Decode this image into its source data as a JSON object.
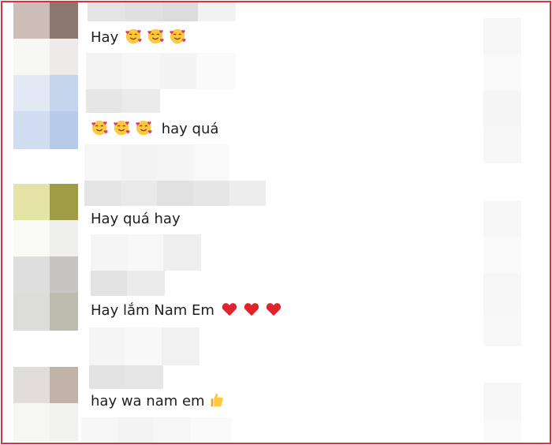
{
  "comments": [
    {
      "text": "Hay",
      "emoji_after": [
        "smiling-face-with-hearts",
        "smiling-face-with-hearts",
        "smiling-face-with-hearts"
      ]
    },
    {
      "emoji_before": [
        "smiling-face-with-hearts",
        "smiling-face-with-hearts",
        "smiling-face-with-hearts"
      ],
      "text": "hay quá"
    },
    {
      "text": "Hay quá hay"
    },
    {
      "text": "Hay lắm Nam Em",
      "emoji_after": [
        "red-heart",
        "red-heart",
        "red-heart"
      ]
    },
    {
      "text": "hay wa nam em",
      "emoji_after": [
        "thumbs-up"
      ]
    }
  ],
  "colors": {
    "frame_border": "#d8333b",
    "text": "#1c1e21",
    "heart": "#e0242c"
  }
}
